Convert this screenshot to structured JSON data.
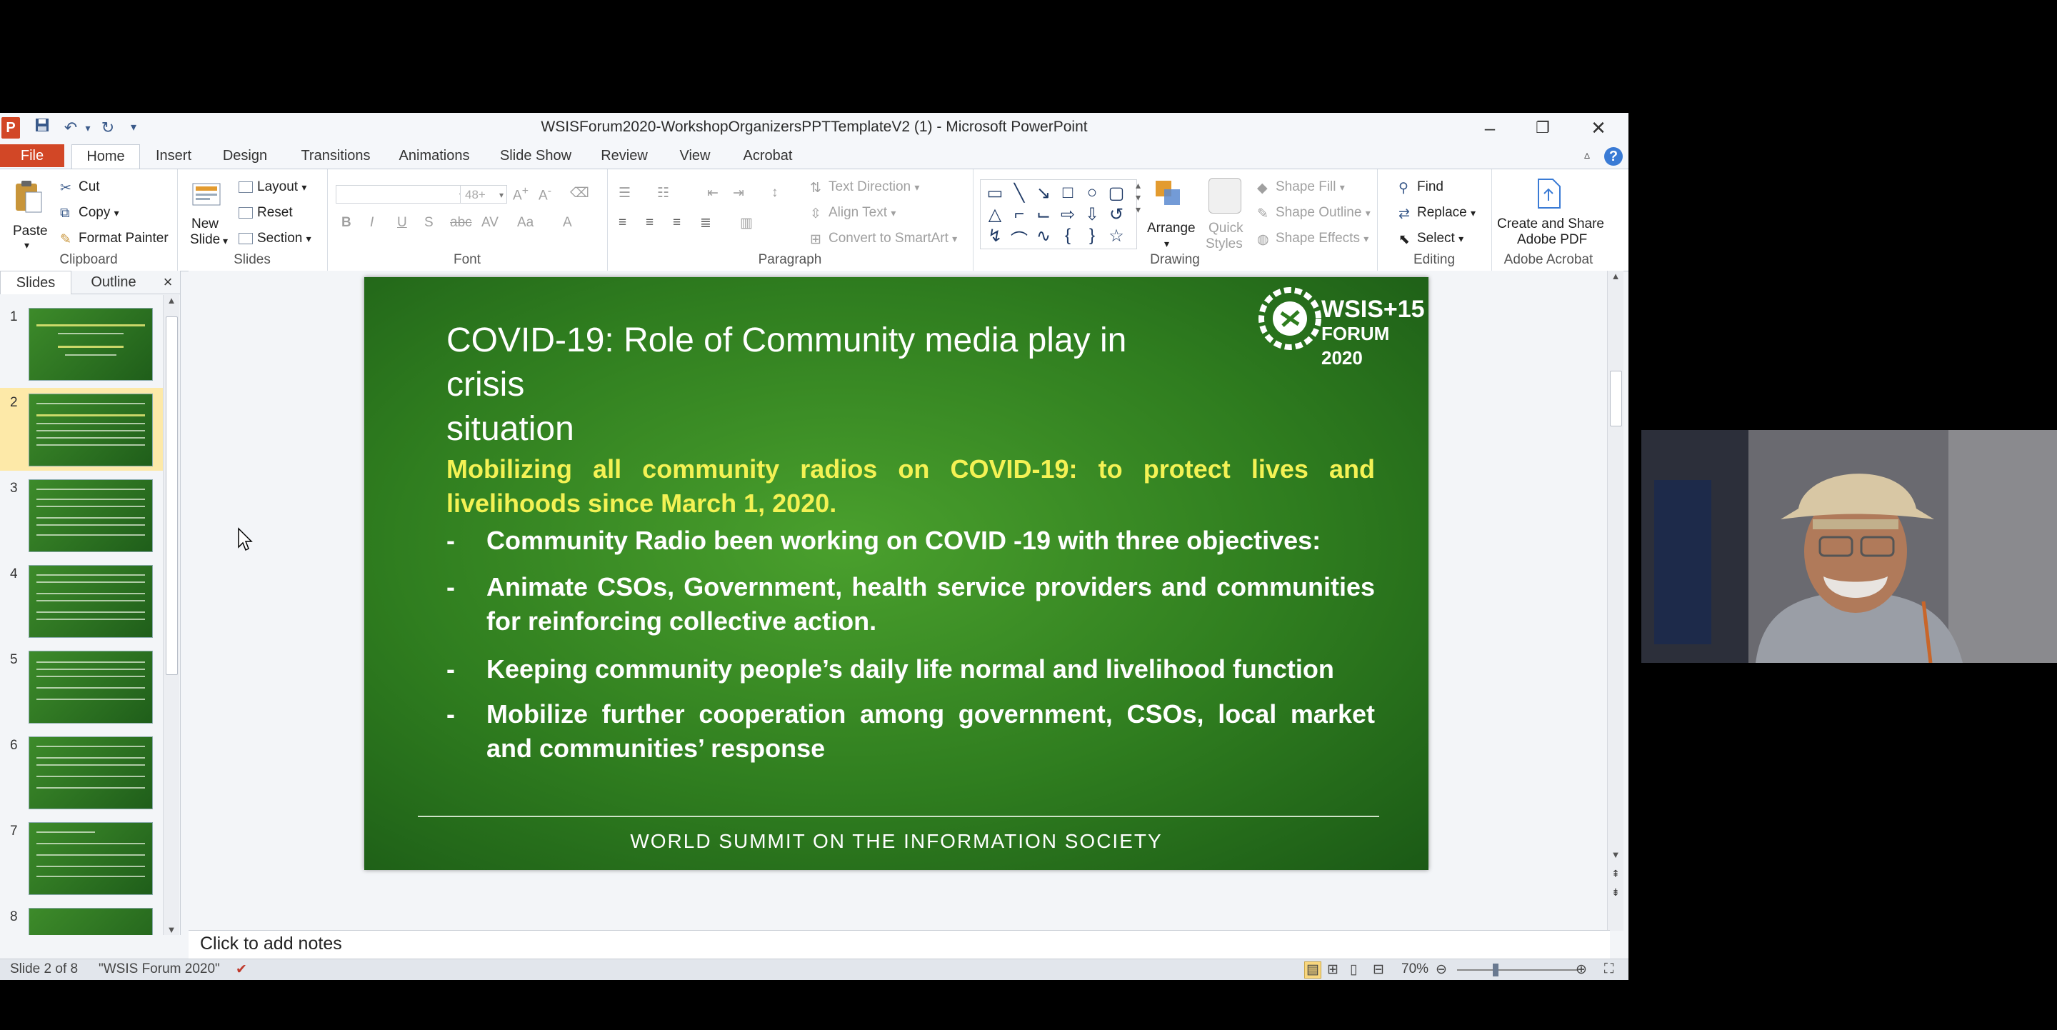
{
  "window": {
    "title": "WSISForum2020-WorkshopOrganizersPPTTemplateV2 (1)  -  Microsoft PowerPoint",
    "app_icon": "P"
  },
  "tabs": {
    "file": "File",
    "items": [
      "Home",
      "Insert",
      "Design",
      "Transitions",
      "Animations",
      "Slide Show",
      "Review",
      "View",
      "Acrobat"
    ]
  },
  "ribbon": {
    "clipboard": {
      "paste": "Paste",
      "cut": "Cut",
      "copy": "Copy",
      "format_painter": "Format Painter",
      "label": "Clipboard"
    },
    "slides": {
      "new_slide_1": "New",
      "new_slide_2": "Slide",
      "layout": "Layout",
      "reset": "Reset",
      "section": "Section",
      "label": "Slides"
    },
    "font": {
      "size": "48+",
      "label": "Font"
    },
    "paragraph": {
      "text_direction": "Text Direction",
      "align_text": "Align Text",
      "convert_smartart": "Convert to SmartArt",
      "label": "Paragraph"
    },
    "drawing": {
      "arrange": "Arrange",
      "quick_styles_1": "Quick",
      "quick_styles_2": "Styles",
      "shape_fill": "Shape Fill",
      "shape_outline": "Shape Outline",
      "shape_effects": "Shape Effects",
      "label": "Drawing"
    },
    "editing": {
      "find": "Find",
      "replace": "Replace",
      "select": "Select",
      "label": "Editing"
    },
    "acrobat": {
      "create_1": "Create and Share",
      "create_2": "Adobe PDF",
      "label": "Adobe Acrobat"
    }
  },
  "slides_pane": {
    "tab_slides": "Slides",
    "tab_outline": "Outline",
    "close": "×",
    "numbers": [
      "1",
      "2",
      "3",
      "4",
      "5",
      "6",
      "7",
      "8"
    ],
    "selected_index": 2
  },
  "slide": {
    "title_line1": "COVID-19: Role  of  Community media play in crisis",
    "title_line2": "situation",
    "logo_line1": "WSIS+15",
    "logo_line2": "FORUM 2020",
    "lead": "Mobilizing  all  community  radios  on  COVID-19:  to  protect  lives  and livelihoods since March 1, 2020.",
    "bullets": [
      "Community Radio been working on COVID -19 with three objectives:",
      "Animate CSOs, Government, health service providers and communities for reinforcing collective action.",
      "Keeping community people’s daily life normal and livelihood function",
      "Mobilize further cooperation among government, CSOs, local market and communities’ response"
    ],
    "bullet_mark": "-",
    "footer": "WORLD SUMMIT ON THE INFORMATION SOCIETY"
  },
  "notes": {
    "placeholder": "Click to add notes"
  },
  "status": {
    "slide_info": "Slide 2 of 8",
    "theme": "\"WSIS Forum 2020\"",
    "zoom": "70%"
  },
  "colors": {
    "file_tab": "#d24726",
    "slide_green": "#2f7d1f",
    "lead_yellow": "#f4f254",
    "selected_thumb": "#fde9a8"
  }
}
